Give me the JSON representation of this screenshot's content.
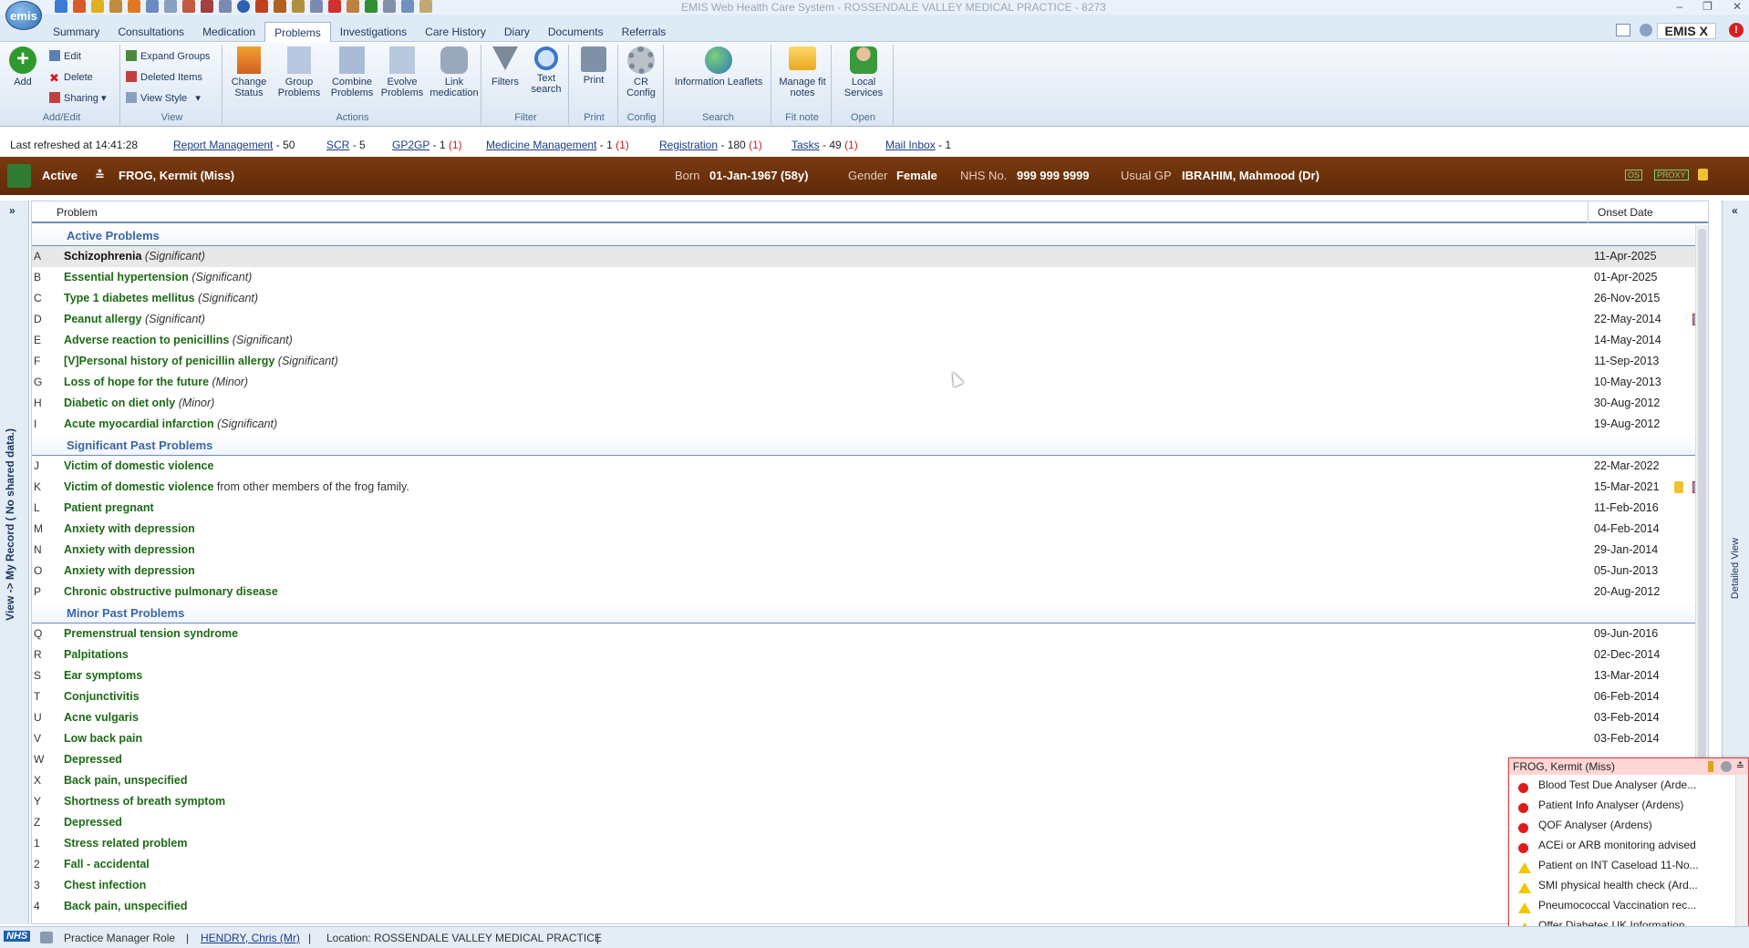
{
  "window": {
    "title": "EMIS Web Health Care System - ROSSENDALE VALLEY MEDICAL PRACTICE - 8273",
    "logo": "emis"
  },
  "tabs": [
    "Summary",
    "Consultations",
    "Medication",
    "Problems",
    "Investigations",
    "Care History",
    "Diary",
    "Documents",
    "Referrals"
  ],
  "active_tab": "Problems",
  "emisx": "EMIS X",
  "ribbon": {
    "add": "Add",
    "edit": "Edit",
    "delete": "Delete",
    "sharing": "Sharing",
    "addedit_label": "Add/Edit",
    "expand_groups": "Expand Groups",
    "deleted_items": "Deleted Items",
    "view_style": "View Style",
    "view_label": "View",
    "change_status": "Change Status",
    "group_problems": "Group Problems",
    "combine_problems": "Combine Problems",
    "evolve_problems": "Evolve Problems",
    "link_medication": "Link medication",
    "actions_label": "Actions",
    "filters": "Filters",
    "text_search": "Text search",
    "filter_label": "Filter",
    "print": "Print",
    "print_label": "Print",
    "cr_config": "CR Config",
    "config_label": "Config",
    "information_leaflets": "Information Leaflets",
    "search_label": "Search",
    "manage_fit_notes": "Manage fit notes",
    "fitnote_label": "Fit note",
    "local_services": "Local Services",
    "open_label": "Open"
  },
  "refresh": {
    "last_refreshed": "Last refreshed at  14:41:28",
    "report_management": "Report Management",
    "report_management_count": "- 50",
    "scr": "SCR",
    "scr_count": "- 5",
    "gp2gp": "GP2GP",
    "gp2gp_count": "- 1",
    "gp2gp_red": "(1)",
    "medicine_management": "Medicine Management",
    "medicine_management_count": "- 1",
    "medicine_management_red": "(1)",
    "registration": "Registration",
    "registration_count": "- 180",
    "registration_red": "(1)",
    "tasks": "Tasks",
    "tasks_count": "- 49",
    "tasks_red": "(1)",
    "mail_inbox": "Mail Inbox",
    "mail_inbox_count": "- 1"
  },
  "patient": {
    "status": "Active",
    "name": "FROG, Kermit (Miss)",
    "born_label": "Born",
    "born": "01-Jan-1967 (58y)",
    "gender_label": "Gender",
    "gender": "Female",
    "nhs_label": "NHS No.",
    "nhs": "999 999 9999",
    "gp_label": "Usual GP",
    "gp": "IBRAHIM, Mahmood (Dr)",
    "badge_os": "OS",
    "badge_proxy": "PROXY"
  },
  "side": {
    "left_text": "View -> My Record ( No shared data.)",
    "right_text": "Detailed View"
  },
  "grid": {
    "col_problem": "Problem",
    "col_onset": "Onset Date",
    "sections": [
      {
        "title": "Active Problems",
        "rows": [
          {
            "letter": "A",
            "name": "Schizophrenia",
            "qual": "(Significant)",
            "date": "11-Apr-2025"
          },
          {
            "letter": "B",
            "name": "Essential hypertension",
            "qual": "(Significant)",
            "date": "01-Apr-2025"
          },
          {
            "letter": "C",
            "name": "Type 1 diabetes mellitus",
            "qual": "(Significant)",
            "date": "26-Nov-2015"
          },
          {
            "letter": "D",
            "name": "Peanut allergy",
            "qual": "(Significant)",
            "date": "22-May-2014"
          },
          {
            "letter": "E",
            "name": "Adverse reaction to penicillins",
            "qual": "(Significant)",
            "date": "14-May-2014"
          },
          {
            "letter": "F",
            "name": "[V]Personal history of penicillin allergy",
            "qual": "(Significant)",
            "date": "11-Sep-2013"
          },
          {
            "letter": "G",
            "name": "Loss of hope for the future",
            "qual": "(Minor)",
            "date": "10-May-2013"
          },
          {
            "letter": "H",
            "name": "Diabetic on diet only",
            "qual": "(Minor)",
            "date": "30-Aug-2012"
          },
          {
            "letter": "I",
            "name": "Acute myocardial infarction",
            "qual": "(Significant)",
            "date": "19-Aug-2012"
          }
        ]
      },
      {
        "title": "Significant Past Problems",
        "rows": [
          {
            "letter": "J",
            "name": "Victim of domestic violence",
            "date": "22-Mar-2022"
          },
          {
            "letter": "K",
            "name": "Victim of domestic violence",
            "extra": "from other members of the frog family.",
            "date": "15-Mar-2021"
          },
          {
            "letter": "L",
            "name": "Patient pregnant",
            "date": "11-Feb-2016"
          },
          {
            "letter": "M",
            "name": "Anxiety with depression",
            "date": "04-Feb-2014"
          },
          {
            "letter": "N",
            "name": "Anxiety with depression",
            "date": "29-Jan-2014"
          },
          {
            "letter": "O",
            "name": "Anxiety with depression",
            "date": "05-Jun-2013"
          },
          {
            "letter": "P",
            "name": "Chronic obstructive pulmonary disease",
            "date": "20-Aug-2012"
          }
        ]
      },
      {
        "title": "Minor Past Problems",
        "rows": [
          {
            "letter": "Q",
            "name": "Premenstrual tension syndrome",
            "date": "09-Jun-2016"
          },
          {
            "letter": "R",
            "name": "Palpitations",
            "date": "02-Dec-2014"
          },
          {
            "letter": "S",
            "name": "Ear symptoms",
            "date": "13-Mar-2014"
          },
          {
            "letter": "T",
            "name": "Conjunctivitis",
            "date": "06-Feb-2014"
          },
          {
            "letter": "U",
            "name": "Acne vulgaris",
            "date": "03-Feb-2014"
          },
          {
            "letter": "V",
            "name": "Low back pain",
            "date": "03-Feb-2014"
          },
          {
            "letter": "W",
            "name": "Depressed",
            "date": ""
          },
          {
            "letter": "X",
            "name": "Back pain, unspecified",
            "date": ""
          },
          {
            "letter": "Y",
            "name": "Shortness of breath symptom",
            "date": ""
          },
          {
            "letter": "Z",
            "name": "Depressed",
            "date": ""
          },
          {
            "letter": "1",
            "name": "Stress related problem",
            "date": ""
          },
          {
            "letter": "2",
            "name": "Fall - accidental",
            "date": ""
          },
          {
            "letter": "3",
            "name": "Chest infection",
            "date": ""
          },
          {
            "letter": "4",
            "name": "Back pain, unspecified",
            "date": ""
          }
        ]
      }
    ]
  },
  "popup": {
    "title": "FROG, Kermit (Miss)",
    "items": [
      {
        "status": "red",
        "text": "Blood Test Due Analyser (Arde..."
      },
      {
        "status": "red",
        "text": "Patient Info Analyser (Ardens)"
      },
      {
        "status": "red",
        "text": "QOF Analyser (Ardens)"
      },
      {
        "status": "red",
        "text": "ACEi or ARB monitoring advised"
      },
      {
        "status": "warn",
        "text": "Patient on INT Caseload 11-No..."
      },
      {
        "status": "warn",
        "text": "SMI physical health check (Ard..."
      },
      {
        "status": "warn",
        "text": "Pneumococcal Vaccination rec..."
      },
      {
        "status": "warn",
        "text": "Offer Diabetes UK Information ..."
      }
    ]
  },
  "status": {
    "nhs": "NHS",
    "role": "Practice Manager Role",
    "user": "HENDRY, Chris (Mr)",
    "location": "Location:  ROSSENDALE VALLEY MEDICAL PRACTICE"
  },
  "colors": {
    "banner": "#6a300c",
    "green_text": "#1d6a16",
    "section_blue": "#3a66a8",
    "link": "#1a3b8a",
    "alert_red": "#d81e1e"
  }
}
